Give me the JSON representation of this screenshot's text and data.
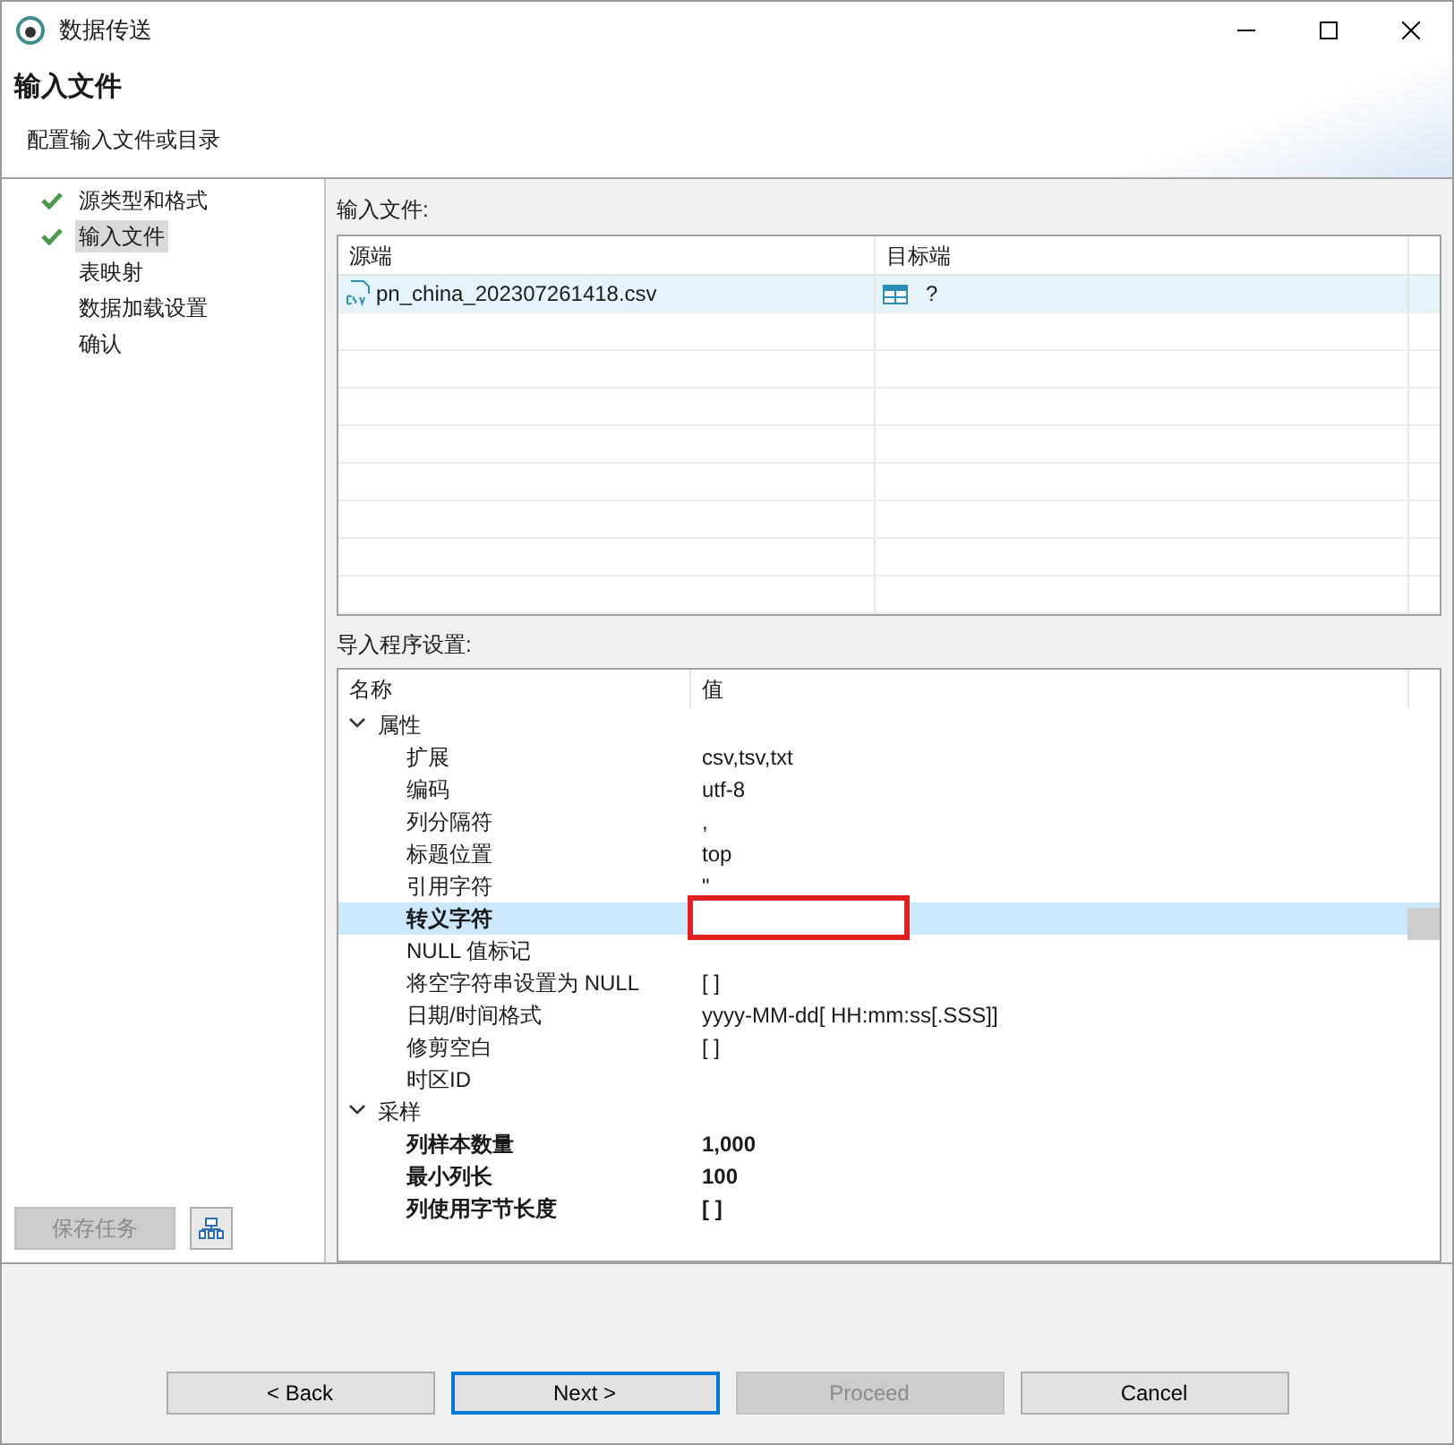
{
  "window": {
    "title": "数据传送"
  },
  "header": {
    "title": "输入文件",
    "subtitle": "配置输入文件或目录"
  },
  "steps": [
    {
      "label": "源类型和格式",
      "done": true,
      "selected": false
    },
    {
      "label": "输入文件",
      "done": true,
      "selected": true
    },
    {
      "label": "表映射",
      "done": false,
      "selected": false
    },
    {
      "label": "数据加载设置",
      "done": false,
      "selected": false
    },
    {
      "label": "确认",
      "done": false,
      "selected": false
    }
  ],
  "save_button": {
    "label": "保存任务",
    "disabled": true
  },
  "input_files": {
    "label": "输入文件:",
    "columns": [
      "源端",
      "目标端"
    ],
    "rows": [
      {
        "source": "pn_china_202307261418.csv",
        "target": "?",
        "selected": true
      }
    ]
  },
  "settings": {
    "label": "导入程序设置:",
    "columns": [
      "名称",
      "值"
    ],
    "groups": [
      {
        "name": "属性",
        "expanded": true,
        "children": [
          {
            "name": "扩展",
            "value": "csv,tsv,txt",
            "bold": false,
            "selected": false,
            "marked": false
          },
          {
            "name": "编码",
            "value": "utf-8",
            "bold": false,
            "selected": false,
            "marked": false
          },
          {
            "name": "列分隔符",
            "value": ",",
            "bold": false,
            "selected": false,
            "marked": false
          },
          {
            "name": "标题位置",
            "value": "top",
            "bold": false,
            "selected": false,
            "marked": false
          },
          {
            "name": "引用字符",
            "value": "\"",
            "bold": false,
            "selected": false,
            "marked": false
          },
          {
            "name": "转义字符",
            "bold": true,
            "selected": true,
            "marked": true
          },
          {
            "name": "NULL 值标记",
            "bold": false,
            "selected": false,
            "marked": false
          },
          {
            "name": "将空字符串设置为 NULL",
            "value": "[ ]",
            "bold": false,
            "selected": false,
            "marked": false
          },
          {
            "name": "日期/时间格式",
            "value": "yyyy-MM-dd[ HH:mm:ss[.SSS]]",
            "bold": false,
            "selected": false,
            "marked": false
          },
          {
            "name": "修剪空白",
            "value": "[ ]",
            "bold": false,
            "selected": false,
            "marked": false
          },
          {
            "name": "时区ID",
            "bold": false,
            "selected": false,
            "marked": false
          }
        ]
      },
      {
        "name": "采样",
        "expanded": true,
        "children": [
          {
            "name": "列样本数量",
            "value": "1,000",
            "bold": true,
            "selected": false,
            "marked": false
          },
          {
            "name": "最小列长",
            "value": "100",
            "bold": true,
            "selected": false,
            "marked": false
          },
          {
            "name": "列使用字节长度",
            "value": "[ ]",
            "bold": true,
            "selected": false,
            "marked": false
          }
        ]
      }
    ]
  },
  "buttons": [
    {
      "label": "< Back",
      "kind": "normal"
    },
    {
      "label": "Next >",
      "kind": "default"
    },
    {
      "label": "Proceed",
      "kind": "disabled"
    },
    {
      "label": "Cancel",
      "kind": "normal"
    }
  ]
}
